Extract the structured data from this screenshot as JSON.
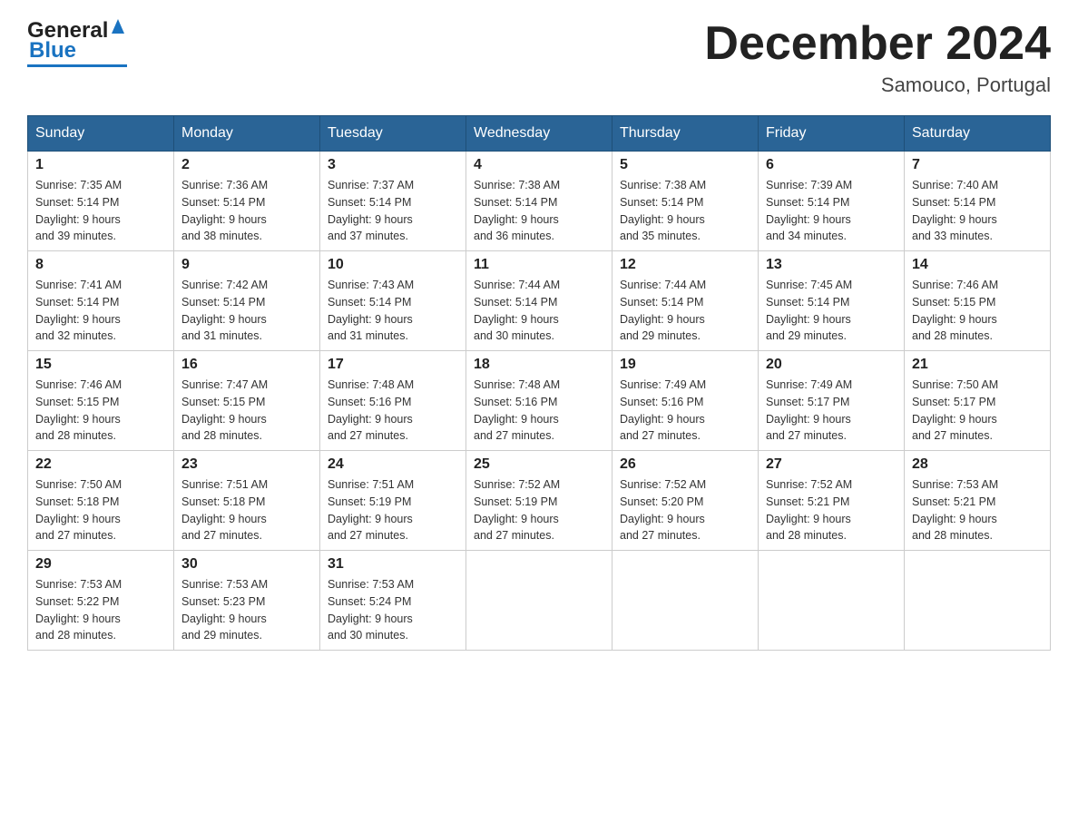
{
  "header": {
    "logo_general": "General",
    "logo_blue": "Blue",
    "month_title": "December 2024",
    "location": "Samouco, Portugal"
  },
  "days_of_week": [
    "Sunday",
    "Monday",
    "Tuesday",
    "Wednesday",
    "Thursday",
    "Friday",
    "Saturday"
  ],
  "weeks": [
    [
      {
        "num": "1",
        "sunrise": "7:35 AM",
        "sunset": "5:14 PM",
        "daylight": "9 hours and 39 minutes."
      },
      {
        "num": "2",
        "sunrise": "7:36 AM",
        "sunset": "5:14 PM",
        "daylight": "9 hours and 38 minutes."
      },
      {
        "num": "3",
        "sunrise": "7:37 AM",
        "sunset": "5:14 PM",
        "daylight": "9 hours and 37 minutes."
      },
      {
        "num": "4",
        "sunrise": "7:38 AM",
        "sunset": "5:14 PM",
        "daylight": "9 hours and 36 minutes."
      },
      {
        "num": "5",
        "sunrise": "7:38 AM",
        "sunset": "5:14 PM",
        "daylight": "9 hours and 35 minutes."
      },
      {
        "num": "6",
        "sunrise": "7:39 AM",
        "sunset": "5:14 PM",
        "daylight": "9 hours and 34 minutes."
      },
      {
        "num": "7",
        "sunrise": "7:40 AM",
        "sunset": "5:14 PM",
        "daylight": "9 hours and 33 minutes."
      }
    ],
    [
      {
        "num": "8",
        "sunrise": "7:41 AM",
        "sunset": "5:14 PM",
        "daylight": "9 hours and 32 minutes."
      },
      {
        "num": "9",
        "sunrise": "7:42 AM",
        "sunset": "5:14 PM",
        "daylight": "9 hours and 31 minutes."
      },
      {
        "num": "10",
        "sunrise": "7:43 AM",
        "sunset": "5:14 PM",
        "daylight": "9 hours and 31 minutes."
      },
      {
        "num": "11",
        "sunrise": "7:44 AM",
        "sunset": "5:14 PM",
        "daylight": "9 hours and 30 minutes."
      },
      {
        "num": "12",
        "sunrise": "7:44 AM",
        "sunset": "5:14 PM",
        "daylight": "9 hours and 29 minutes."
      },
      {
        "num": "13",
        "sunrise": "7:45 AM",
        "sunset": "5:14 PM",
        "daylight": "9 hours and 29 minutes."
      },
      {
        "num": "14",
        "sunrise": "7:46 AM",
        "sunset": "5:15 PM",
        "daylight": "9 hours and 28 minutes."
      }
    ],
    [
      {
        "num": "15",
        "sunrise": "7:46 AM",
        "sunset": "5:15 PM",
        "daylight": "9 hours and 28 minutes."
      },
      {
        "num": "16",
        "sunrise": "7:47 AM",
        "sunset": "5:15 PM",
        "daylight": "9 hours and 28 minutes."
      },
      {
        "num": "17",
        "sunrise": "7:48 AM",
        "sunset": "5:16 PM",
        "daylight": "9 hours and 27 minutes."
      },
      {
        "num": "18",
        "sunrise": "7:48 AM",
        "sunset": "5:16 PM",
        "daylight": "9 hours and 27 minutes."
      },
      {
        "num": "19",
        "sunrise": "7:49 AM",
        "sunset": "5:16 PM",
        "daylight": "9 hours and 27 minutes."
      },
      {
        "num": "20",
        "sunrise": "7:49 AM",
        "sunset": "5:17 PM",
        "daylight": "9 hours and 27 minutes."
      },
      {
        "num": "21",
        "sunrise": "7:50 AM",
        "sunset": "5:17 PM",
        "daylight": "9 hours and 27 minutes."
      }
    ],
    [
      {
        "num": "22",
        "sunrise": "7:50 AM",
        "sunset": "5:18 PM",
        "daylight": "9 hours and 27 minutes."
      },
      {
        "num": "23",
        "sunrise": "7:51 AM",
        "sunset": "5:18 PM",
        "daylight": "9 hours and 27 minutes."
      },
      {
        "num": "24",
        "sunrise": "7:51 AM",
        "sunset": "5:19 PM",
        "daylight": "9 hours and 27 minutes."
      },
      {
        "num": "25",
        "sunrise": "7:52 AM",
        "sunset": "5:19 PM",
        "daylight": "9 hours and 27 minutes."
      },
      {
        "num": "26",
        "sunrise": "7:52 AM",
        "sunset": "5:20 PM",
        "daylight": "9 hours and 27 minutes."
      },
      {
        "num": "27",
        "sunrise": "7:52 AM",
        "sunset": "5:21 PM",
        "daylight": "9 hours and 28 minutes."
      },
      {
        "num": "28",
        "sunrise": "7:53 AM",
        "sunset": "5:21 PM",
        "daylight": "9 hours and 28 minutes."
      }
    ],
    [
      {
        "num": "29",
        "sunrise": "7:53 AM",
        "sunset": "5:22 PM",
        "daylight": "9 hours and 28 minutes."
      },
      {
        "num": "30",
        "sunrise": "7:53 AM",
        "sunset": "5:23 PM",
        "daylight": "9 hours and 29 minutes."
      },
      {
        "num": "31",
        "sunrise": "7:53 AM",
        "sunset": "5:24 PM",
        "daylight": "9 hours and 30 minutes."
      },
      null,
      null,
      null,
      null
    ]
  ],
  "labels": {
    "sunrise": "Sunrise:",
    "sunset": "Sunset:",
    "daylight": "Daylight:"
  }
}
